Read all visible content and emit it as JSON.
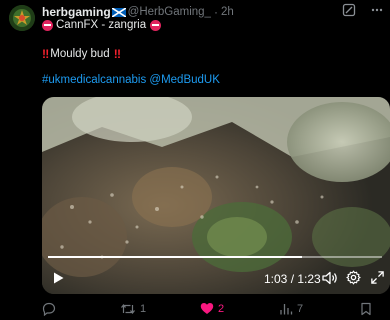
{
  "tweet": {
    "display_name": "herbgaming",
    "handle": "@HerbGaming_",
    "separator": "·",
    "time": "2h",
    "strain_line": "CannFX - zangria",
    "bang": "‼",
    "headline": "Mouldy bud",
    "hashtags": "#ukmedicalcannabis @MedBudUK"
  },
  "video": {
    "current_time": "1:03",
    "duration": "1:23",
    "time_display": "1:03 / 1:23",
    "progress_fraction": 0.76
  },
  "actions": {
    "reply_count": "",
    "retweet_count": "1",
    "like_count": "2",
    "views_count": "7"
  },
  "icons": {
    "avatar": "avatar-icon",
    "flag": "scotland-flag-icon",
    "grok": "grok-icon",
    "more": "more-icon",
    "noentry": "no-entry-icon",
    "bang": "double-exclamation-icon"
  },
  "colors": {
    "accent": "#1d9bf0",
    "like": "#f91880",
    "noentry": "#e0245e"
  }
}
